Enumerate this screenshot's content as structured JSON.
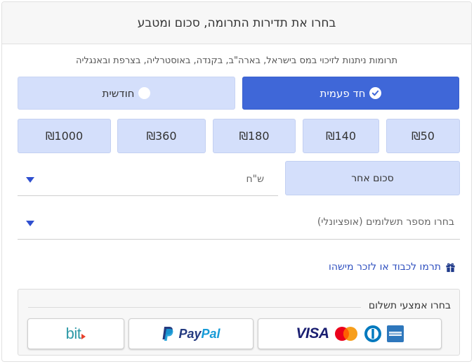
{
  "header": {
    "title": "בחרו את תדירות התרומה, סכום ומטבע"
  },
  "subtitle": "תרומות ניתנות לזיכוי במס בישראל, בארה\"ב, בקנדה, באוסטרליה, בצרפת ובאנגליה",
  "frequency": {
    "once_label": "חד פעמית",
    "monthly_label": "חודשית",
    "selected": "once"
  },
  "amounts": [
    "₪50",
    "₪140",
    "₪180",
    "₪360",
    "₪1000"
  ],
  "other_amount_label": "סכום אחר",
  "currency": {
    "value": "ש\"ח"
  },
  "installments": {
    "placeholder": "בחרו מספר תשלומים (אופציונלי)"
  },
  "honor_link": "תרמו לכבוד או לזכר מישהו",
  "payment": {
    "title": "בחרו אמצעי תשלום",
    "methods": {
      "cards": {
        "visa": "VISA"
      },
      "paypal": {
        "pay": "Pay",
        "pal": "Pal"
      },
      "bit": {
        "text": "bit"
      }
    }
  },
  "colors": {
    "primary": "#3f67d8",
    "light": "#d4dffb",
    "link": "#2e4fbf",
    "arrow": "#2f4fcf"
  }
}
